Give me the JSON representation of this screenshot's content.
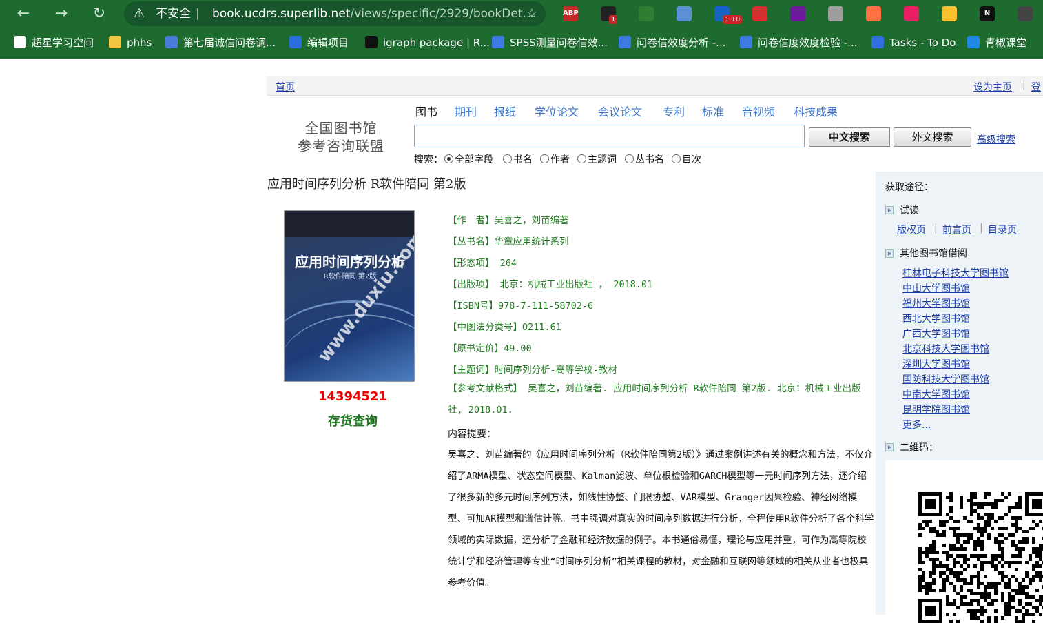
{
  "browser": {
    "insecure_label": "不安全",
    "url_host": "book.ucdrs.superlib.net",
    "url_path": "/views/specific/2929/bookDet...",
    "extensions": [
      {
        "name": "abp",
        "label": "ABP",
        "color": "#c62828"
      },
      {
        "name": "ext-2",
        "label": "",
        "color": "#222222",
        "badge": "1"
      },
      {
        "name": "ext-3",
        "label": "",
        "color": "#2e7d32"
      },
      {
        "name": "ext-4",
        "label": "",
        "color": "#5c8fd6"
      },
      {
        "name": "ext-5",
        "label": "",
        "color": "#1565c0",
        "badge": "1.10"
      },
      {
        "name": "ext-6",
        "label": "",
        "color": "#d32f2f"
      },
      {
        "name": "ext-7",
        "label": "",
        "color": "#6a1b9a"
      },
      {
        "name": "ext-8",
        "label": "",
        "color": "#9e9e9e"
      },
      {
        "name": "ext-9",
        "label": "",
        "color": "#ff7043"
      },
      {
        "name": "ext-10",
        "label": "",
        "color": "#e91e63"
      },
      {
        "name": "ext-11",
        "label": "",
        "color": "#fbc02d"
      },
      {
        "name": "ext-12",
        "label": "N",
        "color": "#111111"
      },
      {
        "name": "ext-13",
        "label": "",
        "color": "#444444"
      }
    ],
    "bookmarks": [
      {
        "label": "超星学习空间",
        "color": "#ffffff"
      },
      {
        "label": "phhs",
        "color": "#f4c542"
      },
      {
        "label": "第七届诚信问卷调...",
        "color": "#4a7bd8"
      },
      {
        "label": "编辑项目",
        "color": "#2a6fdb"
      },
      {
        "label": "igraph package | R...",
        "color": "#111111"
      },
      {
        "label": "SPSS测量问卷信效...",
        "color": "#3d7be0"
      },
      {
        "label": "问卷信效度分析 -...",
        "color": "#3d7be0"
      },
      {
        "label": "问卷信度效度检验 -...",
        "color": "#3d7be0"
      },
      {
        "label": "Tasks - To Do",
        "color": "#2f6fe0"
      },
      {
        "label": "青椒课堂",
        "color": "#1e88e5"
      }
    ]
  },
  "topnav": {
    "home": "首页",
    "set_home": "设为主页",
    "login": "登"
  },
  "logo": {
    "line1": "全国图书馆",
    "line2": "参考咨询联盟"
  },
  "categories": [
    "图书",
    "期刊",
    "报纸",
    "学位论文",
    "会议论文",
    "专利",
    "标准",
    "音视频",
    "科技成果"
  ],
  "search": {
    "value": "",
    "cn_button": "中文搜索",
    "foreign_button": "外文搜索",
    "advanced": "高级搜索",
    "scope_label": "搜索：",
    "scopes": [
      "全部字段",
      "书名",
      "作者",
      "主题词",
      "丛书名",
      "目次"
    ],
    "selected_scope": "全部字段"
  },
  "book": {
    "title": "应用时间序列分析  R软件陪同  第2版",
    "cover_title": "应用时间序列分析",
    "cover_subtitle": "R软件陪同  第2版",
    "cover_watermark": "www.duxiu.com",
    "ssid": "14394521",
    "stock_check": "存货查询",
    "fields": [
      {
        "label": "【作　者】",
        "value": "吴喜之，刘苗编著"
      },
      {
        "label": "【丛书名】",
        "value": "华章应用统计系列"
      },
      {
        "label": "【形态项】",
        "value": " 264"
      },
      {
        "label": "【出版项】",
        "value": " 北京：机械工业出版社 ， 2018.01"
      },
      {
        "label": "【ISBN号】",
        "value": "978-7-111-58702-6"
      },
      {
        "label": "【中图法分类号】",
        "value": "O211.61"
      },
      {
        "label": "【原书定价】",
        "value": "49.00"
      },
      {
        "label": "【主题词】",
        "value": "时间序列分析-高等学校-教材"
      }
    ],
    "citation_label": "【参考文献格式】",
    "citation": " 吴喜之，刘苗编著. 应用时间序列分析 R软件陪同 第2版. 北京：机械工业出版社, 2018.01.",
    "summary_label": "内容提要：",
    "summary": "吴喜之、刘苗编著的《应用时间序列分析（R软件陪同第2版）》通过案例讲述有关的概念和方法，不仅介绍了ARMA模型、状态空间模型、Kalman滤波、单位根检验和GARCH模型等一元时间序列方法，还介绍了很多新的多元时间序列方法，如线性协整、门限协整、VAR模型、Granger因果检验、神经网络模型、可加AR模型和谱估计等。书中强调对真实的时间序列数据进行分析，全程使用R软件分析了各个科学领域的实际数据，还分析了金融和经济数据的例子。本书通俗易懂，理论与应用并重，可作为高等院校统计学和经济管理等专业“时间序列分析”相关课程的教材，对金融和互联网等领域的相关从业者也极具参考价值。"
  },
  "panel": {
    "title": "获取途径：",
    "trial": "试读",
    "trial_links": [
      "版权页",
      "前言页",
      "目录页"
    ],
    "other_libs_label": "其他图书馆借阅",
    "libraries": [
      "桂林电子科技大学图书馆",
      "中山大学图书馆",
      "福州大学图书馆",
      "西北大学图书馆",
      "广西大学图书馆",
      "北京科技大学图书馆",
      "深圳大学图书馆",
      "国防科技大学图书馆",
      "中南大学图书馆",
      "昆明学院图书馆"
    ],
    "more": "更多...",
    "qr_label": "二维码："
  }
}
